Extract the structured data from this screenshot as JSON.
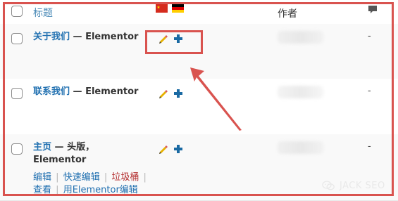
{
  "table": {
    "columns": {
      "title": "标题",
      "author": "作者"
    },
    "rows": [
      {
        "title": "关于我们",
        "separator": "—",
        "builder": "Elementor",
        "comments": "-"
      },
      {
        "title": "联系我们",
        "separator": "—",
        "builder": "Elementor",
        "comments": "-"
      },
      {
        "title_line1": "主页",
        "separator": "—",
        "title_state": "头版，",
        "builder": "Elementor",
        "actions": {
          "edit": "编辑",
          "quick_edit": "快速编辑",
          "trash": "垃圾桶",
          "view": "查看",
          "edit_with_elementor": "用Elementor编辑"
        },
        "comments": "-"
      }
    ]
  },
  "icons": {
    "flag_cn": "china-flag-icon",
    "flag_de": "germany-flag-icon",
    "comment": "comment-bubble-icon",
    "pencil": "pencil-edit-icon",
    "plus": "add-translation-icon"
  },
  "watermark": {
    "text": "JACK SEO"
  },
  "colors": {
    "annotation_red": "#d9534f",
    "link_blue": "#2271b1",
    "danger_red": "#b32d2e"
  }
}
